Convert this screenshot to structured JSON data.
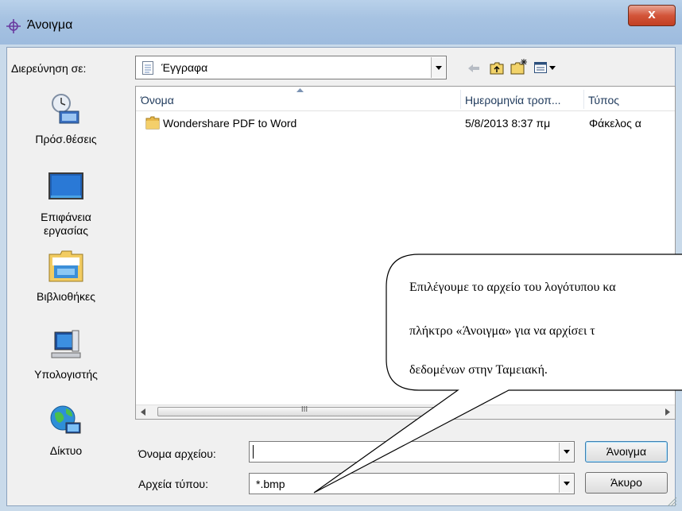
{
  "window": {
    "title": "Άνοιγμα",
    "close_label": "x"
  },
  "toolbar": {
    "lookin_label": "Διερεύνηση σε:",
    "lookin_value": "Έγγραφα",
    "back_icon": "back-arrow-icon",
    "up_icon": "up-folder-icon",
    "newfolder_icon": "new-folder-icon",
    "views_icon": "view-menu-icon"
  },
  "places": [
    {
      "label": "Πρόσ.θέσεις",
      "icon": "recent-places-icon"
    },
    {
      "label": "Επιφάνεια εργασίας",
      "icon": "desktop-icon"
    },
    {
      "label": "Βιβλιοθήκες",
      "icon": "libraries-icon"
    },
    {
      "label": "Υπολογιστής",
      "icon": "computer-icon"
    },
    {
      "label": "Δίκτυο",
      "icon": "network-icon"
    }
  ],
  "list": {
    "columns": [
      "Όνομα",
      "Ημερομηνία τροπ...",
      "Τύπος"
    ],
    "rows": [
      {
        "name": "Wondershare PDF to Word",
        "date": "5/8/2013 8:37 πμ",
        "type": "Φάκελος α",
        "icon": "folder-icon"
      }
    ],
    "scroll_grip": "III"
  },
  "footer": {
    "filename_label": "Όνομα αρχείου:",
    "filename_value": "",
    "filetype_label": "Αρχεία τύπου:",
    "filetype_value": "*.bmp",
    "open_button": "Άνοιγμα",
    "cancel_button": "Άκυρο"
  },
  "callout": {
    "line1": "Επιλέγουμε το αρχείο του λογότυπου  κα",
    "line2": "πλήκτρο  «Άνοιγμα»  για  να  αρχίσει  τ",
    "line3": "δεδομένων στην Ταμειακή."
  },
  "colors": {
    "accent": "#1e395b",
    "close_red": "#c23f22",
    "folder": "#e8b84a"
  }
}
